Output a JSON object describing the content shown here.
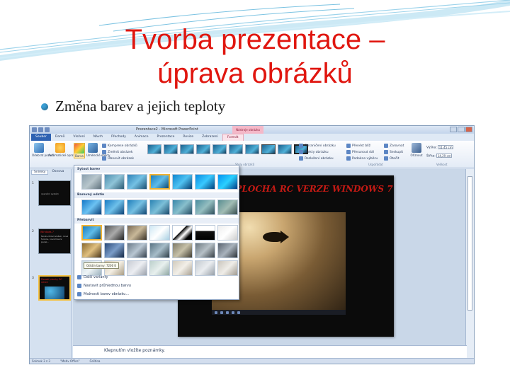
{
  "slide": {
    "title_line1": "Tvorba prezentace –",
    "title_line2": "úprava obrázků",
    "bullet": "Změna barev a jejich teploty"
  },
  "app": {
    "window_title": "Prezentace2 - Microsoft PowerPoint",
    "context_tab": "Nástroje obrázku",
    "tabs": [
      "Soubor",
      "Domů",
      "Vložení",
      "Návrh",
      "Přechody",
      "Animace",
      "Prezentace",
      "Revize",
      "Zobrazení",
      "Formát"
    ],
    "ribbon": {
      "remove_background": "Odebrat pozadí",
      "corrections": "Automatické opravy",
      "color": "Barva",
      "artistic_effects": "Umělecké efekty",
      "compress": "Komprese obrázků",
      "change_picture": "Změnit obrázek",
      "reset_picture": "Obnovit obrázek",
      "picture_styles_group": "Styly obrázků",
      "picture_border": "Ohraničení obrázku",
      "picture_effects": "Efekty obrázku",
      "picture_layout": "Rozložení obrázku",
      "bring_forward": "Přenést blíž",
      "send_backward": "Přesunout dál",
      "selection_pane": "Podokno výběru",
      "align": "Zarovnat",
      "group": "Seskupit",
      "rotate": "Otočit",
      "arrange_group": "Uspořádat",
      "crop": "Oříznout",
      "height_label": "Výška:",
      "height_value": "11,45 cm",
      "width_label": "Šířka:",
      "width_value": "14,29 cm",
      "size_group": "Velikost"
    },
    "pane_tabs": [
      "Snímky",
      "Osnova"
    ],
    "slide_numbers": [
      "1",
      "2",
      "3"
    ],
    "thumbnails": [
      {
        "title": "",
        "text": "operační systém"
      },
      {
        "title": "Windows 7",
        "text": "Nově vzhled složek, nové funkce, nová hlavní panel..."
      },
      {
        "title": "Pozadí plochy RC verze",
        "text": ""
      }
    ],
    "current_slide_heading": "PLOCHA RC VERZE WINDOWS 7",
    "notes_placeholder": "Klepnutím vložíte poznámky.",
    "status": {
      "slide_count": "Snímek 3 z 3",
      "theme": "\"Motiv Office\"",
      "language": "Čeština"
    },
    "dropdown": {
      "section_saturation": "Sytost barev",
      "section_tone": "Barevný odstín",
      "section_recolor": "Přebarvit",
      "tooltip": "Odstín barvy: 7200 K",
      "more_variations": "Další varianty",
      "transparent_color": "Nastavit průhlednou barvu",
      "options": "Možnosti barev obrázku..."
    }
  },
  "colors": {
    "title_red": "#e0160f",
    "bullet_blue": "#3a9fd6",
    "selection_gold": "#f0b233"
  }
}
